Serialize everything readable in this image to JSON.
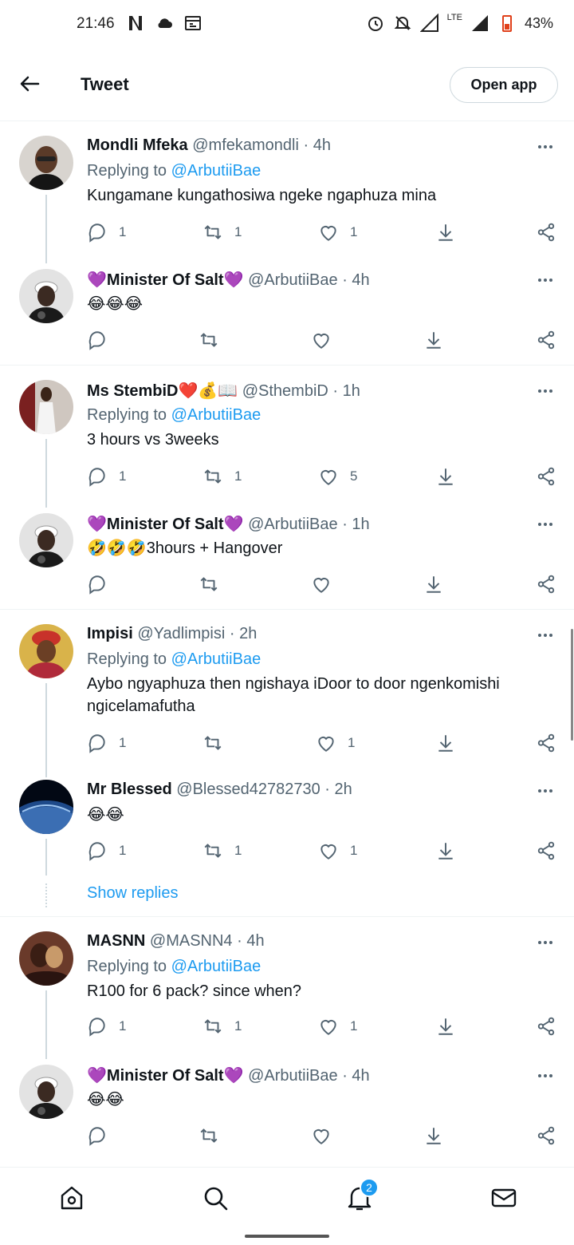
{
  "status_bar": {
    "time": "21:46",
    "battery": "43%",
    "network": "LTE"
  },
  "header": {
    "title": "Tweet",
    "open_app_label": "Open app"
  },
  "tweets": [
    {
      "name": "Mondli Mfeka",
      "handle": "@mfekamondli",
      "time": "· 4h",
      "replying_prefix": "Replying to",
      "replying_to": "@ArbutiiBae",
      "text": "Kungamane kungathosiwa ngeke ngaphuza mina",
      "replies": "1",
      "retweets": "1",
      "likes": "1"
    },
    {
      "name": "💜Minister Of Salt💜",
      "handle": "@ArbutiiBae",
      "time": "· 4h",
      "text": "😂😂😂",
      "replies": "",
      "retweets": "",
      "likes": ""
    },
    {
      "name": "Ms StembiD❤️💰📖",
      "handle": "@SthembiD",
      "time": "· 1h",
      "replying_prefix": "Replying to",
      "replying_to": "@ArbutiiBae",
      "text": "3 hours vs 3weeks",
      "replies": "1",
      "retweets": "1",
      "likes": "5"
    },
    {
      "name": "💜Minister Of Salt💜",
      "handle": "@ArbutiiBae",
      "time": "· 1h",
      "text": "🤣🤣🤣3hours + Hangover",
      "replies": "",
      "retweets": "",
      "likes": ""
    },
    {
      "name": "Impisi",
      "handle": "@Yadlimpisi",
      "time": "· 2h",
      "replying_prefix": "Replying to",
      "replying_to": "@ArbutiiBae",
      "text": "Aybo ngyaphuza then ngishaya iDoor to door ngenkomishi ngicelamafutha",
      "replies": "1",
      "retweets": "",
      "likes": "1"
    },
    {
      "name": "Mr Blessed",
      "handle": "@Blessed42782730",
      "time": "· 2h",
      "text": "😂😂",
      "replies": "1",
      "retweets": "1",
      "likes": "1"
    },
    {
      "name": "MASNN",
      "handle": "@MASNN4",
      "time": "· 4h",
      "replying_prefix": "Replying to",
      "replying_to": "@ArbutiiBae",
      "text": "R100 for 6 pack? since when?",
      "replies": "1",
      "retweets": "1",
      "likes": "1"
    },
    {
      "name": "💜Minister Of Salt💜",
      "handle": "@ArbutiiBae",
      "time": "· 4h",
      "text": "😂😂",
      "replies": "",
      "retweets": "",
      "likes": ""
    }
  ],
  "show_replies_label": "Show replies",
  "bottom_nav": {
    "notifications_badge": "2"
  },
  "colors": {
    "accent": "#1d9bf0",
    "text": "#0f1419",
    "secondary": "#536471"
  }
}
